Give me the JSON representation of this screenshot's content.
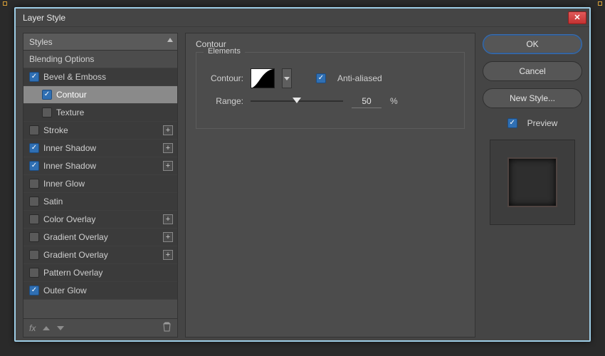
{
  "window": {
    "title": "Layer Style"
  },
  "styles_panel": {
    "header": "Styles",
    "blending": "Blending Options",
    "items": [
      {
        "label": "Bevel & Emboss",
        "checked": true
      },
      {
        "label": "Contour",
        "checked": true,
        "sub": true,
        "selected": true
      },
      {
        "label": "Texture",
        "checked": false,
        "sub": true
      },
      {
        "label": "Stroke",
        "checked": false,
        "add": true
      },
      {
        "label": "Inner Shadow",
        "checked": true,
        "add": true
      },
      {
        "label": "Inner Shadow",
        "checked": true,
        "add": true
      },
      {
        "label": "Inner Glow",
        "checked": false
      },
      {
        "label": "Satin",
        "checked": false
      },
      {
        "label": "Color Overlay",
        "checked": false,
        "add": true
      },
      {
        "label": "Gradient Overlay",
        "checked": false,
        "add": true
      },
      {
        "label": "Gradient Overlay",
        "checked": false,
        "add": true
      },
      {
        "label": "Pattern Overlay",
        "checked": false
      },
      {
        "label": "Outer Glow",
        "checked": true
      }
    ],
    "fx_label": "fx"
  },
  "contour_panel": {
    "title": "Contour",
    "legend": "Elements",
    "contour_label": "Contour:",
    "antialiased_label": "Anti-aliased",
    "antialiased_checked": true,
    "range_label": "Range:",
    "range_value": "50",
    "range_unit": "%"
  },
  "buttons": {
    "ok": "OK",
    "cancel": "Cancel",
    "new_style": "New Style...",
    "preview": "Preview",
    "preview_checked": true
  }
}
